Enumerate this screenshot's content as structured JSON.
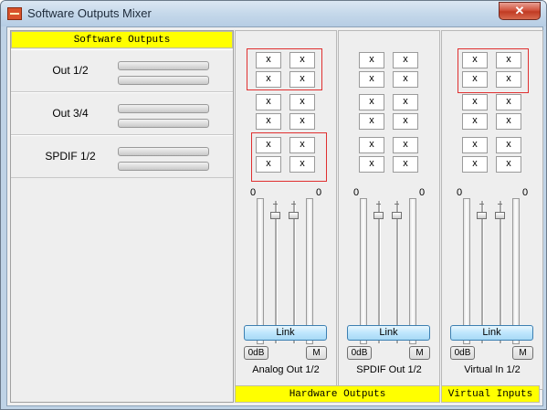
{
  "window": {
    "title": "Software Outputs Mixer",
    "close_glyph": "✕"
  },
  "left_panel": {
    "header": "Software Outputs",
    "outputs": [
      {
        "label": "Out 1/2"
      },
      {
        "label": "Out 3/4"
      },
      {
        "label": "SPDIF 1/2"
      }
    ]
  },
  "cell_value": "x",
  "strips": [
    {
      "label": "Analog Out 1/2",
      "left_level": "0",
      "right_level": "0",
      "link_label": "Link",
      "odb_label": "0dB",
      "mute_label": "M"
    },
    {
      "label": "SPDIF Out 1/2",
      "left_level": "0",
      "right_level": "0",
      "link_label": "Link",
      "odb_label": "0dB",
      "mute_label": "M"
    },
    {
      "label": "Virtual In 1/2",
      "left_level": "0",
      "right_level": "0",
      "link_label": "Link",
      "odb_label": "0dB",
      "mute_label": "M"
    }
  ],
  "footer": {
    "hardware_outputs": "Hardware Outputs",
    "virtual_inputs": "Virtual Inputs"
  },
  "colors": {
    "header_yellow": "#ffff00",
    "highlight_red": "#e03030",
    "link_blue": "#bee6fd"
  }
}
